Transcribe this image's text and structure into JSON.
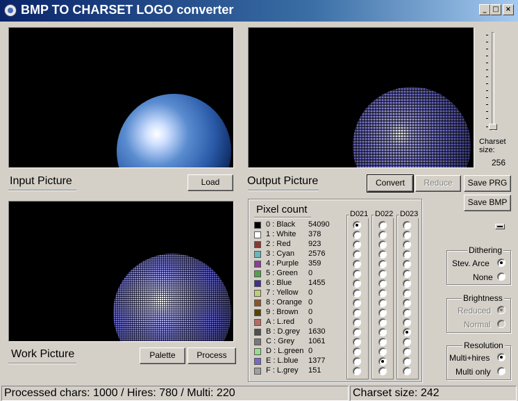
{
  "window": {
    "title": "BMP TO CHARSET LOGO converter",
    "minimize": "_",
    "maximize": "□",
    "close": "×"
  },
  "panels": {
    "input_label": "Input Picture",
    "output_label": "Output Picture",
    "work_label": "Work Picture"
  },
  "buttons": {
    "load": "Load",
    "convert": "Convert",
    "reduce": "Reduce",
    "save_prg": "Save PRG",
    "save_bmp": "Save BMP",
    "palette": "Palette",
    "process": "Process"
  },
  "charset": {
    "label": "Charset size:",
    "value": "256"
  },
  "pixel_count": {
    "title": "Pixel count",
    "columns": [
      "D021",
      "D022",
      "D023"
    ],
    "rows": [
      {
        "label": "0 : Black",
        "count": "54090",
        "color": "#000000",
        "d021": true,
        "d022": false,
        "d023": false
      },
      {
        "label": "1 : White",
        "count": "378",
        "color": "#ffffff",
        "d021": false,
        "d022": false,
        "d023": false
      },
      {
        "label": "2 : Red",
        "count": "923",
        "color": "#883932",
        "d021": false,
        "d022": false,
        "d023": false
      },
      {
        "label": "3 : Cyan",
        "count": "2576",
        "color": "#67b6bd",
        "d021": false,
        "d022": false,
        "d023": false
      },
      {
        "label": "4 : Purple",
        "count": "359",
        "color": "#8b3f96",
        "d021": false,
        "d022": false,
        "d023": false
      },
      {
        "label": "5 : Green",
        "count": "0",
        "color": "#55a049",
        "d021": false,
        "d022": false,
        "d023": false
      },
      {
        "label": "6 : Blue",
        "count": "1455",
        "color": "#40318d",
        "d021": false,
        "d022": false,
        "d023": false
      },
      {
        "label": "7 : Yellow",
        "count": "0",
        "color": "#bfce72",
        "d021": false,
        "d022": false,
        "d023": false
      },
      {
        "label": "8 : Orange",
        "count": "0",
        "color": "#8b5429",
        "d021": false,
        "d022": false,
        "d023": false
      },
      {
        "label": "9 : Brown",
        "count": "0",
        "color": "#574200",
        "d021": false,
        "d022": false,
        "d023": false
      },
      {
        "label": "A : L.red",
        "count": "0",
        "color": "#b86962",
        "d021": false,
        "d022": false,
        "d023": false
      },
      {
        "label": "B : D.grey",
        "count": "1630",
        "color": "#505050",
        "d021": false,
        "d022": false,
        "d023": true
      },
      {
        "label": "C : Grey",
        "count": "1061",
        "color": "#787878",
        "d021": false,
        "d022": false,
        "d023": false
      },
      {
        "label": "D : L.green",
        "count": "0",
        "color": "#94e089",
        "d021": false,
        "d022": false,
        "d023": false
      },
      {
        "label": "E : L.blue",
        "count": "1377",
        "color": "#7869c4",
        "d021": false,
        "d022": true,
        "d023": false
      },
      {
        "label": "F : L.grey",
        "count": "151",
        "color": "#9f9f9f",
        "d021": false,
        "d022": false,
        "d023": false
      }
    ]
  },
  "dithering": {
    "title": "Dithering",
    "options": [
      {
        "label": "Stev. Arce",
        "checked": true
      },
      {
        "label": "None",
        "checked": false
      }
    ]
  },
  "brightness": {
    "title": "Brightness",
    "options": [
      {
        "label": "Reduced",
        "checked": true
      },
      {
        "label": "Normal",
        "checked": false
      }
    ]
  },
  "resolution": {
    "title": "Resolution",
    "options": [
      {
        "label": "Multi+hires",
        "checked": true
      },
      {
        "label": "Multi only",
        "checked": false
      }
    ]
  },
  "status": {
    "left": "Processed chars: 1000 / Hires: 780 / Multi: 220",
    "right": "Charset size: 242"
  }
}
